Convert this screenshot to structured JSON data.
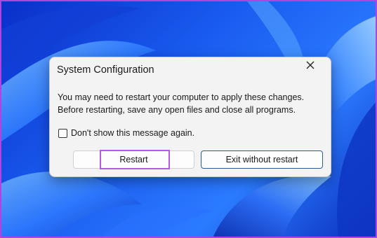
{
  "dialog": {
    "title": "System Configuration",
    "message_line1": "You may need to restart your computer to apply these changes.",
    "message_line2": "Before restarting, save any open files and close all programs.",
    "checkbox_label": "Don't show this message again.",
    "checkbox_checked": false,
    "restart_label": "Restart",
    "exit_label": "Exit without restart",
    "close_icon": "close-icon"
  },
  "colors": {
    "highlight": "#b45be8",
    "desktop_blue": "#1a5cf0",
    "dialog_bg": "#f3f3f3",
    "primary_border": "#2a5a9a"
  }
}
